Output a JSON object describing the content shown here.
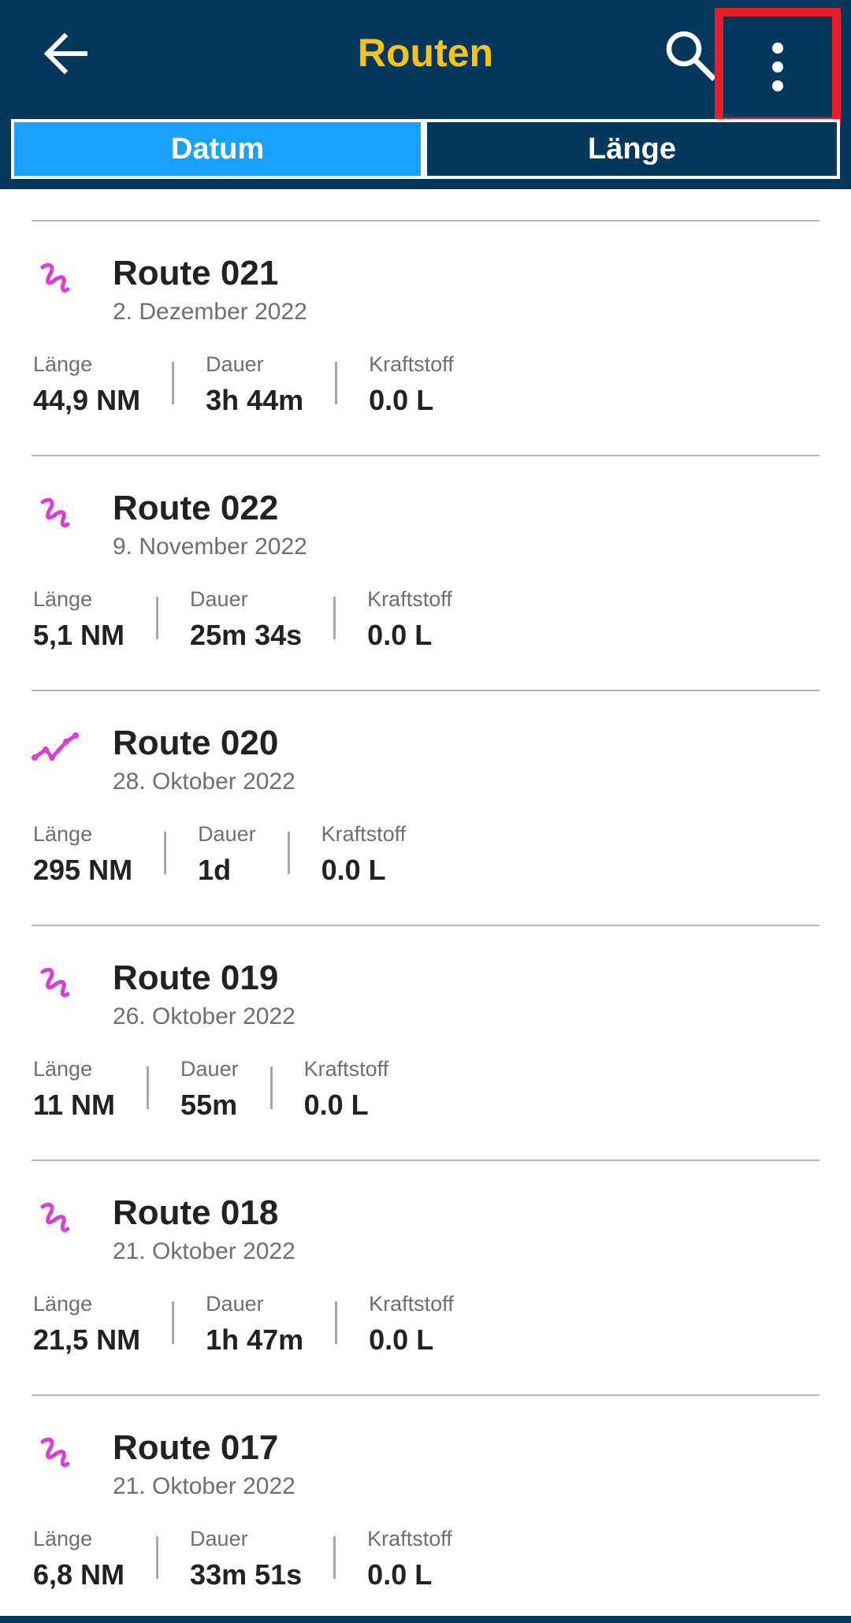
{
  "header": {
    "title": "Routen",
    "back_icon": "arrow-left-icon",
    "search_icon": "search-icon",
    "more_icon": "more-vertical-icon",
    "colors": {
      "bar": "#03375c",
      "title": "#f7c21a",
      "highlight": "#e3202a"
    }
  },
  "tabs": [
    {
      "label": "Datum",
      "active": true
    },
    {
      "label": "Länge",
      "active": false
    }
  ],
  "labels": {
    "length": "Länge",
    "duration": "Dauer",
    "fuel": "Kraftstoff"
  },
  "routes": [
    {
      "name": "Route 021",
      "date": "2. Dezember 2022",
      "length": "44,9 NM",
      "duration": "3h 44m",
      "fuel": "0.0 L",
      "icon": "squiggle-route-icon"
    },
    {
      "name": "Route 022",
      "date": "9. November 2022",
      "length": "5,1 NM",
      "duration": "25m 34s",
      "fuel": "0.0 L",
      "icon": "squiggle-route-icon"
    },
    {
      "name": "Route 020",
      "date": "28. Oktober 2022",
      "length": "295 NM",
      "duration": "1d",
      "fuel": "0.0 L",
      "icon": "zigzag-route-icon"
    },
    {
      "name": "Route 019",
      "date": "26. Oktober 2022",
      "length": "11 NM",
      "duration": "55m",
      "fuel": "0.0 L",
      "icon": "squiggle-route-icon"
    },
    {
      "name": "Route 018",
      "date": "21. Oktober 2022",
      "length": "21,5 NM",
      "duration": "1h 47m",
      "fuel": "0.0 L",
      "icon": "squiggle-route-icon"
    },
    {
      "name": "Route 017",
      "date": "21. Oktober 2022",
      "length": "6,8 NM",
      "duration": "33m 51s",
      "fuel": "0.0 L",
      "icon": "squiggle-route-icon"
    }
  ],
  "accent_color": "#d93fd6"
}
